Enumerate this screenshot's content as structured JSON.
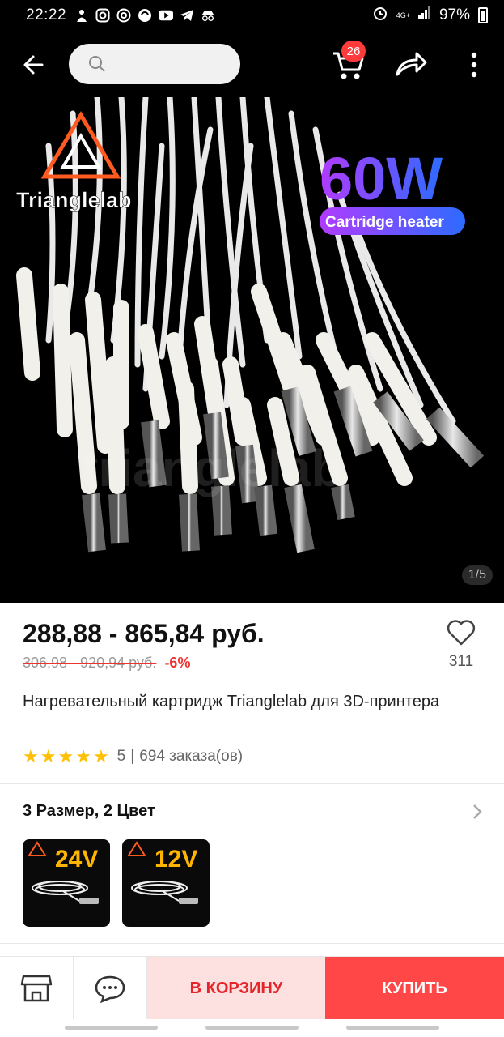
{
  "status_bar": {
    "time": "22:22",
    "network": "4G+",
    "battery": "97%",
    "icons": [
      "notification-icon",
      "instagram-icon",
      "at-icon",
      "app-icon",
      "youtube-icon",
      "telegram-icon",
      "incognito-icon",
      "alarm-icon",
      "signal-icon",
      "battery-icon"
    ]
  },
  "header": {
    "search_placeholder": "",
    "cart_count": "26"
  },
  "gallery": {
    "indicator": "1/5",
    "brand_text": "Trianglelab",
    "headline": "60W",
    "subheadline": "Cartridge heater",
    "watermark": "trianglelab",
    "colors": {
      "headline_gradient_start": "#b13bff",
      "headline_gradient_end": "#2d6bff"
    }
  },
  "product": {
    "price": "288,88 - 865,84 руб.",
    "old_price": "306,98 - 920,94 руб.",
    "discount": "-6%",
    "favorites": "311",
    "title": "Нагревательный картридж Trianglelab для 3D-принтера",
    "rating": "5",
    "orders": "694 заказа(ов)"
  },
  "variants": {
    "title": "3 Размер, 2 Цвет",
    "items": [
      {
        "label": "24V",
        "color": "#ffb400"
      },
      {
        "label": "12V",
        "color": "#ffb400"
      }
    ]
  },
  "actions": {
    "add_to_cart": "В КОРЗИНУ",
    "buy": "КУПИТЬ"
  },
  "colors": {
    "accent": "#ff4747",
    "accent_soft": "#fde0e0",
    "star": "#ffc107"
  }
}
